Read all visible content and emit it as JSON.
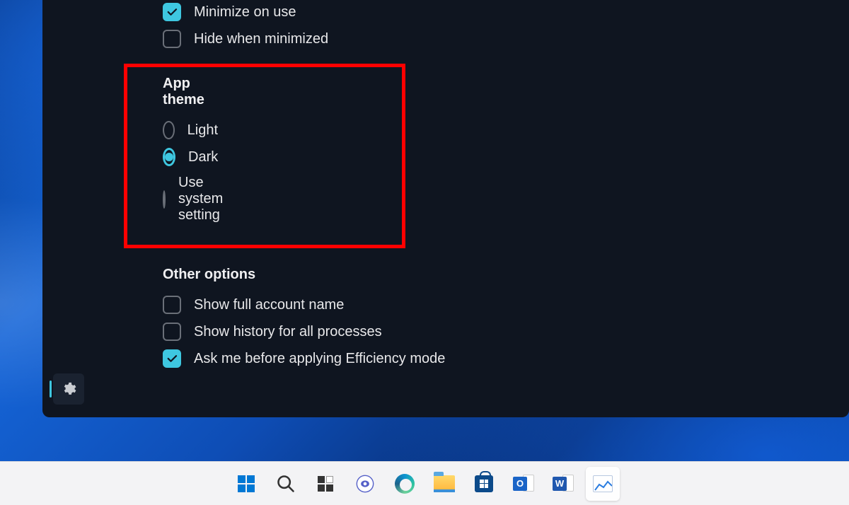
{
  "settings": {
    "minimize_on_use": {
      "label": "Minimize on use",
      "checked": true
    },
    "hide_when_minimized": {
      "label": "Hide when minimized",
      "checked": false
    },
    "app_theme": {
      "title": "App theme",
      "options": {
        "light": {
          "label": "Light",
          "selected": false
        },
        "dark": {
          "label": "Dark",
          "selected": true
        },
        "system": {
          "label": "Use system setting",
          "selected": false
        }
      }
    },
    "other": {
      "title": "Other options",
      "show_full_account": {
        "label": "Show full account name",
        "checked": false
      },
      "show_history_all": {
        "label": "Show history for all processes",
        "checked": false
      },
      "efficiency_confirm": {
        "label": "Ask me before applying Efficiency mode",
        "checked": true
      }
    }
  },
  "taskbar": {
    "items": [
      "start",
      "search",
      "task-view",
      "chat",
      "edge",
      "file-explorer",
      "microsoft-store",
      "outlook",
      "word",
      "task-manager"
    ]
  },
  "office_letters": {
    "outlook": "O",
    "word": "W"
  }
}
